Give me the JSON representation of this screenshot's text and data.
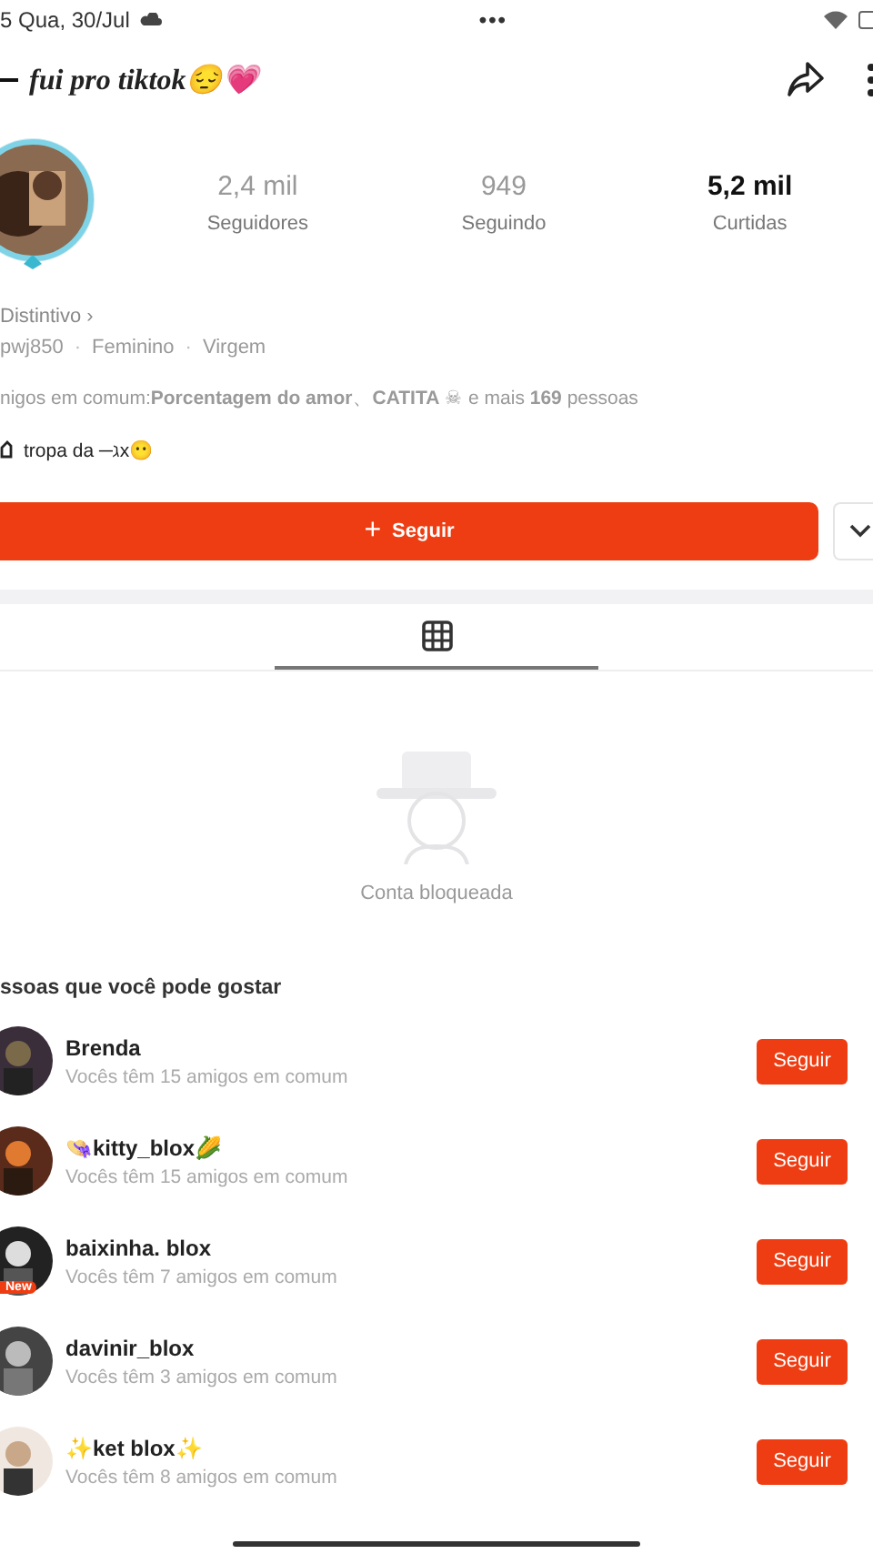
{
  "status_bar": {
    "time": "5 Qua, 30/Jul",
    "more": "•••"
  },
  "header": {
    "title": "fui pro tiktok😔💗"
  },
  "stats": [
    {
      "value": "2,4 mil",
      "label": "Seguidores",
      "emphasis": false
    },
    {
      "value": "949",
      "label": "Seguindo",
      "emphasis": false
    },
    {
      "value": "5,2 mil",
      "label": "Curtidas",
      "emphasis": true
    }
  ],
  "badge_link": "Distintivo ›",
  "info": [
    "pwj850",
    "Feminino",
    "Virgem"
  ],
  "info_separator": "·",
  "mutual": "nigos em comum:**Porcentagem do amor**、**CATITA** ☠ e mais **169** pessoas",
  "group": "tropa da ─ℷx😶",
  "follow_button": {
    "label": "Seguir",
    "icon": "+"
  },
  "tabs": [
    {
      "kind": "grid",
      "selected": true
    }
  ],
  "blocked": {
    "message": "Conta bloqueada"
  },
  "suggestions": {
    "title": "ssoas que você pode gostar",
    "people": [
      {
        "name": "Brenda",
        "mutual": "Vocês têm 15 amigos em comum",
        "button": "Seguir"
      },
      {
        "name": "👒kitty_blox🌽",
        "mutual": "Vocês têm 15 amigos em comum",
        "button": "Seguir"
      },
      {
        "name": "baixinha. blox",
        "mutual": "Vocês têm 7 amigos em comum",
        "badge": "New",
        "button": "Seguir"
      },
      {
        "name": "davinir_blox",
        "mutual": "Vocês têm 3 amigos em comum",
        "button": "Seguir"
      },
      {
        "name": "✨ket blox✨",
        "mutual": "Vocês têm 8 amigos em comum",
        "button": "Seguir"
      }
    ]
  }
}
